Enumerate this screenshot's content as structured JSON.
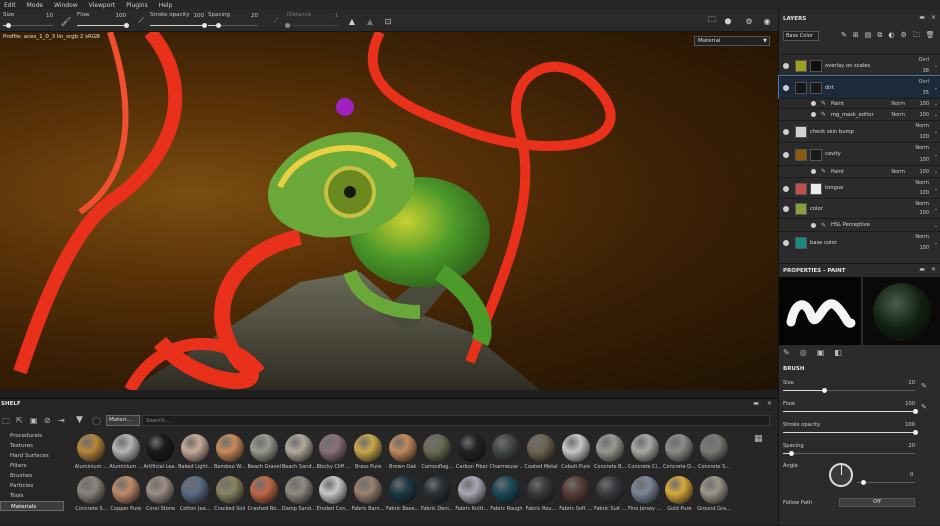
{
  "menubar": [
    "Edit",
    "Mode",
    "Window",
    "Viewport",
    "Plugins",
    "Help"
  ],
  "toolbar": {
    "size": {
      "label": "Size",
      "value": "10",
      "level": 0.1
    },
    "flow": {
      "label": "Flow",
      "value": "100",
      "level": 1.0
    },
    "stroke_opacity": {
      "label": "Stroke opacity",
      "value": "100",
      "level": 1.0
    },
    "spacing": {
      "label": "Spacing",
      "value": "20",
      "level": 0.2
    },
    "distance": {
      "label": "Distance",
      "value": "1",
      "level": 0.0
    }
  },
  "viewport": {
    "profile": "Profile: aces_1_0_3 lin_srgb 2 sRGB",
    "display_mode": "Material"
  },
  "shelf": {
    "title": "SHELF",
    "filter_chip": "Materi...",
    "search_placeholder": "Search...",
    "categories": [
      "Procedurals",
      "Textures",
      "Hard Surfaces",
      "Filters",
      "Brushes",
      "Particles",
      "Tools",
      "Materials"
    ],
    "selected_category": "Materials",
    "materials": [
      {
        "name": "Aluminium ...",
        "color": "#b8863a"
      },
      {
        "name": "Aluminium ...",
        "color": "#b5b5b5"
      },
      {
        "name": "Artificial Lea...",
        "color": "#1a1a1a"
      },
      {
        "name": "Baked Light...",
        "color": "#c8aa98"
      },
      {
        "name": "Bamboo W...",
        "color": "#c98a5a"
      },
      {
        "name": "Beach Gravel",
        "color": "#9a9a92"
      },
      {
        "name": "Beach Sand...",
        "color": "#b2aa9c"
      },
      {
        "name": "Blocky Cliff ...",
        "color": "#8a7078"
      },
      {
        "name": "Brass Pure",
        "color": "#c9a74c"
      },
      {
        "name": "Brown Oak",
        "color": "#c08a5c"
      },
      {
        "name": "Camouflag...",
        "color": "#6b6b55"
      },
      {
        "name": "Carbon Fiber",
        "color": "#222222"
      },
      {
        "name": "Charmeuse ...",
        "color": "#444848"
      },
      {
        "name": "Coated Metal",
        "color": "#6f6450"
      },
      {
        "name": "Cobalt Pure",
        "color": "#c7c7c7"
      },
      {
        "name": "Concrete B...",
        "color": "#9a9a94"
      },
      {
        "name": "Concrete Cl...",
        "color": "#a7a9a4"
      },
      {
        "name": "Concrete D...",
        "color": "#8c8c88"
      },
      {
        "name": "Concrete S...",
        "color": "#7a7a76"
      },
      {
        "name": "Concrete S...",
        "color": "#8a847c"
      },
      {
        "name": "Copper Pure",
        "color": "#c08a6a"
      },
      {
        "name": "Coral Stone",
        "color": "#9a8e84"
      },
      {
        "name": "Cotton Jea...",
        "color": "#5a6e86"
      },
      {
        "name": "Cracked Soil",
        "color": "#8a8460"
      },
      {
        "name": "Crashed Ro...",
        "color": "#c06848"
      },
      {
        "name": "Damp Sand...",
        "color": "#8e8a80"
      },
      {
        "name": "Eroded Con...",
        "color": "#c8c8c6"
      },
      {
        "name": "Fabric Barn...",
        "color": "#9a8070"
      },
      {
        "name": "Fabric Base...",
        "color": "#1c3a48"
      },
      {
        "name": "Fabric Deni...",
        "color": "#2a3238"
      },
      {
        "name": "Fabric Knitt...",
        "color": "#a8a8b4"
      },
      {
        "name": "Fabric Rough",
        "color": "#1a4a5a"
      },
      {
        "name": "Fabric Rou...",
        "color": "#3a3838"
      },
      {
        "name": "Fabric Soft ...",
        "color": "#5a3e36"
      },
      {
        "name": "Fabric Suit ...",
        "color": "#3a3c40"
      },
      {
        "name": "Fine Jersey ...",
        "color": "#7a8698"
      },
      {
        "name": "Gold Pure",
        "color": "#d8aa3c"
      },
      {
        "name": "Ground Gra...",
        "color": "#9a9688"
      }
    ]
  },
  "layers": {
    "title": "LAYERS",
    "channel": "Base Color",
    "items": [
      {
        "name": "overlay on scales",
        "blend": "Ovrl",
        "opacity": "38",
        "thumb": "#a0a020",
        "mask": "#0e0e0e",
        "indent": 0,
        "selected": false
      },
      {
        "name": "dirt",
        "blend": "Ovrl",
        "opacity": "35",
        "thumb": "#151515",
        "mask": "#1a1a1a",
        "indent": 0,
        "selected": true
      },
      {
        "name": "Paint",
        "blend": "Norm",
        "opacity": "100",
        "thumb": "",
        "mask": "",
        "indent": 1,
        "selected": false
      },
      {
        "name": "mg_mask_editor",
        "blend": "Norm",
        "opacity": "100",
        "thumb": "",
        "mask": "",
        "indent": 1,
        "selected": false
      },
      {
        "name": "check skin bump",
        "blend": "Norm",
        "opacity": "100",
        "thumb": "#d0d0d0",
        "mask": "",
        "indent": 0,
        "selected": false
      },
      {
        "name": "cavity",
        "blend": "Norm",
        "opacity": "100",
        "thumb": "#8a5a10",
        "mask": "#1a1a1a",
        "indent": 0,
        "selected": false
      },
      {
        "name": "Paint",
        "blend": "Norm",
        "opacity": "100",
        "thumb": "",
        "mask": "",
        "indent": 1,
        "selected": false
      },
      {
        "name": "tongue",
        "blend": "Norm",
        "opacity": "100",
        "thumb": "#c05050",
        "mask": "#ececec",
        "indent": 0,
        "selected": false
      },
      {
        "name": "color",
        "blend": "Norm",
        "opacity": "100",
        "thumb": "#8aa040",
        "mask": "",
        "indent": 0,
        "selected": false
      },
      {
        "name": "HSL Perceptive",
        "blend": "",
        "opacity": "",
        "thumb": "",
        "mask": "",
        "indent": 1,
        "selected": false
      },
      {
        "name": "base color",
        "blend": "Norm",
        "opacity": "100",
        "thumb": "#1a8a80",
        "mask": "",
        "indent": 0,
        "selected": false
      }
    ]
  },
  "properties": {
    "title": "PROPERTIES - PAINT",
    "section": "BRUSH",
    "size": {
      "label": "Size",
      "value": "10",
      "level": 0.31
    },
    "flow": {
      "label": "Flow",
      "value": "100",
      "level": 1.0
    },
    "stroke_opacity": {
      "label": "Stroke opacity",
      "value": "100",
      "level": 1.0
    },
    "spacing": {
      "label": "Spacing",
      "value": "20",
      "level": 0.06
    },
    "angle": {
      "label": "Angle",
      "value": "0"
    },
    "follow_path": {
      "label": "Follow Path",
      "value": "Off"
    }
  }
}
